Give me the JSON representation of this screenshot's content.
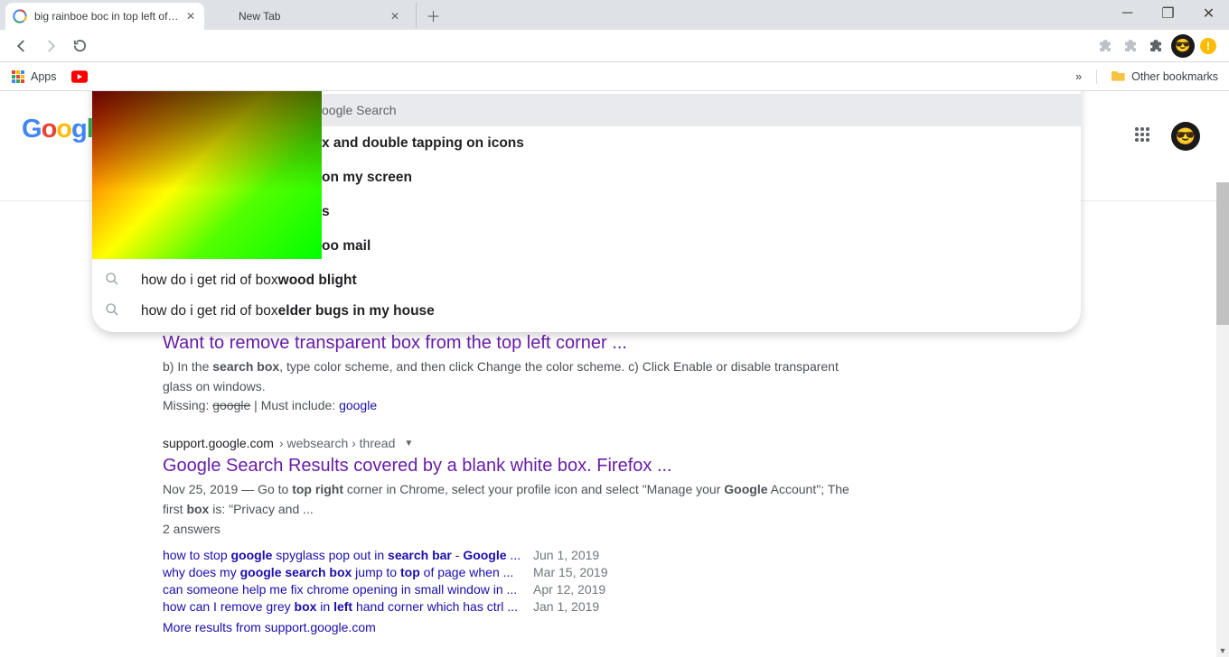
{
  "tabs": [
    {
      "title": "big rainboe boc in top left of goo"
    },
    {
      "title": "New Tab"
    }
  ],
  "bookmarks_bar": {
    "apps": "Apps",
    "chev": "»",
    "other": "Other bookmarks"
  },
  "search": {
    "google_search_label": "oogle Search",
    "suggestions_partial": [
      {
        "bold": "x and double tapping on icons"
      },
      {
        "bold": " on my screen"
      },
      {
        "bold": "s"
      },
      {
        "bold": "oo mail"
      }
    ],
    "suggestions_full": [
      {
        "pre": "how do i get rid of box",
        "bold": "wood blight"
      },
      {
        "pre": "how do i get rid of box",
        "bold": "elder bugs in my house"
      }
    ]
  },
  "results": {
    "r1": {
      "title": "Want to remove transparent box from the top left corner ...",
      "snippet_a": "b) In the ",
      "snippet_b": "search box",
      "snippet_c": ", type color scheme, and then click Change the color scheme. c) Click Enable or disable transparent glass on windows.",
      "missing": "Missing: ",
      "missing_term": "google",
      "must_include": " | Must include: ",
      "must_link": "google"
    },
    "r2": {
      "crumb_host": "support.google.com",
      "crumb_path": " › websearch › thread",
      "title": "Google Search Results covered by a blank white box. Firefox ...",
      "date": "Nov 25, 2019",
      "snip_a": " — Go to ",
      "snip_b": "top right",
      "snip_c": " corner in Chrome, select your profile icon and select \"Manage your ",
      "snip_d": "Google",
      "snip_e": " Account\"; The first ",
      "snip_f": "box",
      "snip_g": " is: \"Privacy and ...",
      "answers": "2 answers",
      "sub": [
        {
          "q_pre": "how to stop ",
          "q_b1": "google",
          "q_mid": " spyglass pop out in ",
          "q_b2": "search bar",
          "q_mid2": " - ",
          "q_b3": "Google",
          "q_tail": " ...",
          "date": "Jun 1, 2019"
        },
        {
          "q_pre": "why does my ",
          "q_b1": "google search box",
          "q_mid": " jump to ",
          "q_b2": "top",
          "q_mid2": " of page when ...",
          "q_b3": "",
          "q_tail": "",
          "date": "Mar 15, 2019"
        },
        {
          "q_pre": "can someone help me fix chrome opening in small window in ...",
          "q_b1": "",
          "q_mid": "",
          "q_b2": "",
          "q_mid2": "",
          "q_b3": "",
          "q_tail": "",
          "date": "Apr 12, 2019"
        },
        {
          "q_pre": "how can I remove grey ",
          "q_b1": "box",
          "q_mid": " in ",
          "q_b2": "left",
          "q_mid2": " hand corner which has ctrl ...",
          "q_b3": "",
          "q_tail": "",
          "date": "Jan 1, 2019"
        }
      ],
      "more": "More results from support.google.com"
    }
  }
}
